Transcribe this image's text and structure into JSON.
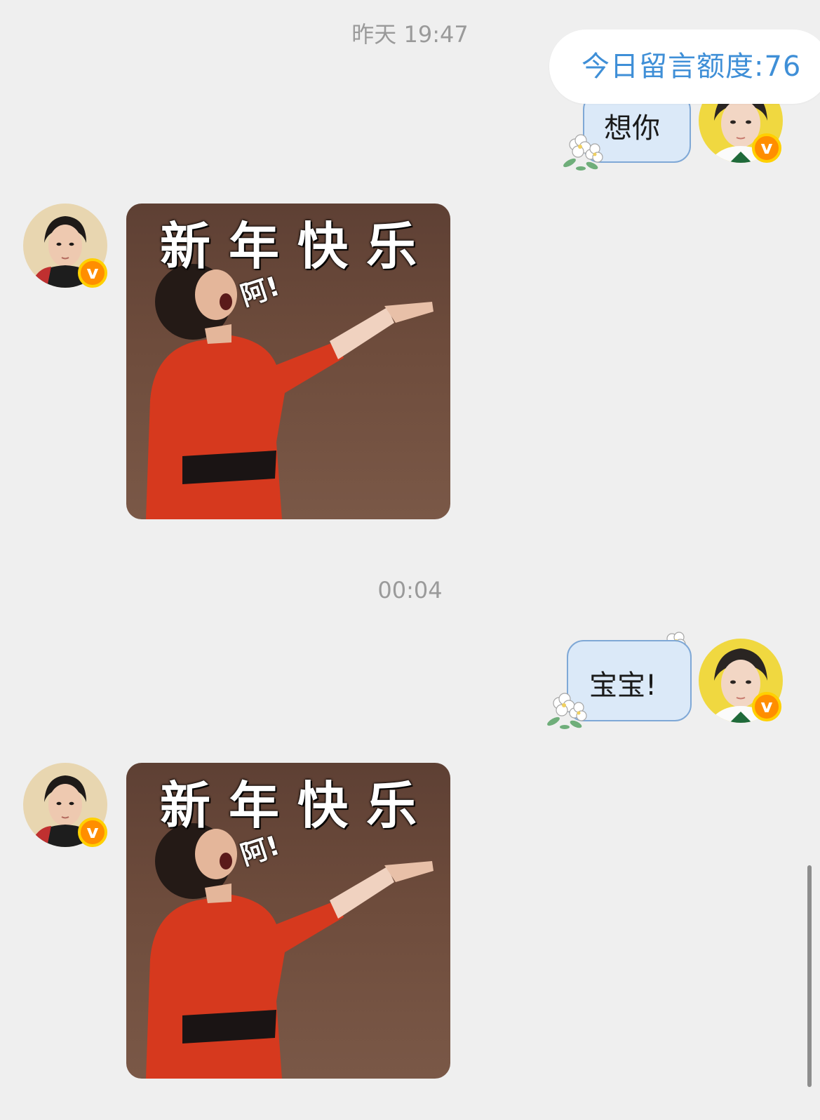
{
  "quota": {
    "label": "今日留言额度:76"
  },
  "messages": [
    {
      "type": "timestamp",
      "text": "昨天 19:47"
    },
    {
      "type": "text",
      "side": "right",
      "text": "想你"
    },
    {
      "type": "sticker",
      "side": "left",
      "caption": "新年快乐",
      "sfx": "阿!"
    },
    {
      "type": "timestamp",
      "text": "00:04"
    },
    {
      "type": "text",
      "side": "right",
      "text": "宝宝!"
    },
    {
      "type": "sticker",
      "side": "left",
      "caption": "新年快乐",
      "sfx": "阿!"
    }
  ],
  "badge": {
    "label": "v"
  },
  "colors": {
    "background": "#efefef",
    "quota_text": "#3f8fd7",
    "bubble_fill": "#dbe9f8",
    "bubble_border": "#7fa8d6",
    "verified_badge": "#ff8e00"
  }
}
